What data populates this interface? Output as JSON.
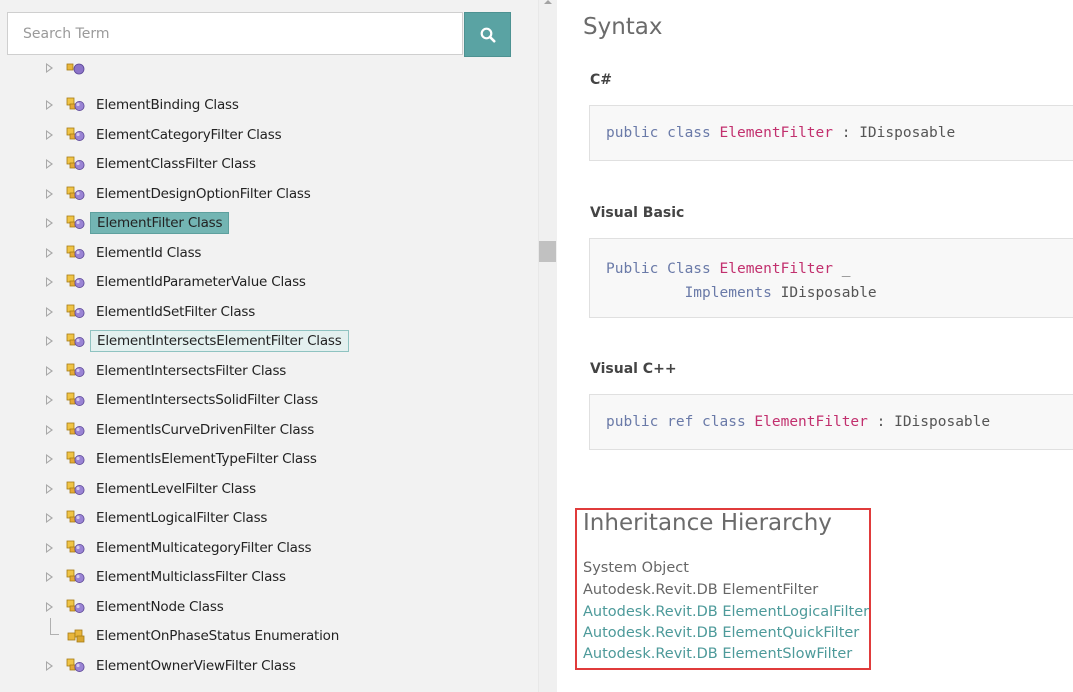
{
  "search": {
    "placeholder": "Search Term"
  },
  "tree": {
    "items": [
      {
        "label": "ElementBinding Class",
        "kind": "class",
        "state": "normal"
      },
      {
        "label": "ElementCategoryFilter Class",
        "kind": "class",
        "state": "normal"
      },
      {
        "label": "ElementClassFilter Class",
        "kind": "class",
        "state": "normal"
      },
      {
        "label": "ElementDesignOptionFilter Class",
        "kind": "class",
        "state": "normal"
      },
      {
        "label": "ElementFilter Class",
        "kind": "class",
        "state": "selected"
      },
      {
        "label": "ElementId Class",
        "kind": "class",
        "state": "normal"
      },
      {
        "label": "ElementIdParameterValue Class",
        "kind": "class",
        "state": "normal"
      },
      {
        "label": "ElementIdSetFilter Class",
        "kind": "class",
        "state": "normal"
      },
      {
        "label": "ElementIntersectsElementFilter Class",
        "kind": "class",
        "state": "hovered"
      },
      {
        "label": "ElementIntersectsFilter Class",
        "kind": "class",
        "state": "normal"
      },
      {
        "label": "ElementIntersectsSolidFilter Class",
        "kind": "class",
        "state": "normal"
      },
      {
        "label": "ElementIsCurveDrivenFilter Class",
        "kind": "class",
        "state": "normal"
      },
      {
        "label": "ElementIsElementTypeFilter Class",
        "kind": "class",
        "state": "normal"
      },
      {
        "label": "ElementLevelFilter Class",
        "kind": "class",
        "state": "normal"
      },
      {
        "label": "ElementLogicalFilter Class",
        "kind": "class",
        "state": "normal"
      },
      {
        "label": "ElementMulticategoryFilter Class",
        "kind": "class",
        "state": "normal"
      },
      {
        "label": "ElementMulticlassFilter Class",
        "kind": "class",
        "state": "normal"
      },
      {
        "label": "ElementNode Class",
        "kind": "class",
        "state": "normal"
      },
      {
        "label": "ElementOnPhaseStatus Enumeration",
        "kind": "enum",
        "state": "normal"
      },
      {
        "label": "ElementOwnerViewFilter Class",
        "kind": "class",
        "state": "normal"
      }
    ]
  },
  "content": {
    "syntax_heading": "Syntax",
    "csharp": {
      "label": "C#",
      "kw1": "public class ",
      "type": "ElementFilter",
      "rest": " : IDisposable"
    },
    "vb": {
      "label": "Visual Basic",
      "kw1": "Public Class ",
      "type": "ElementFilter",
      "rest": " _",
      "line2_kw": "Implements",
      "line2_rest": " IDisposable"
    },
    "cpp": {
      "label": "Visual C++",
      "kw1": "public ref class ",
      "type": "ElementFilter",
      "rest": " : IDisposable"
    },
    "hierarchy": {
      "heading": "Inheritance Hierarchy",
      "items": [
        {
          "text": "System Object",
          "link": false
        },
        {
          "text": "Autodesk.Revit.DB ElementFilter",
          "link": false
        },
        {
          "text": "Autodesk.Revit.DB ElementLogicalFilter",
          "link": true
        },
        {
          "text": "Autodesk.Revit.DB ElementQuickFilter",
          "link": true
        },
        {
          "text": "Autodesk.Revit.DB ElementSlowFilter",
          "link": true
        }
      ]
    }
  },
  "colors": {
    "accent": "#5aa3a3",
    "selected": "#73b5b3",
    "type_name": "#c2306e",
    "keyword": "#6a7aa8",
    "highlight_border": "#e03b3b"
  }
}
